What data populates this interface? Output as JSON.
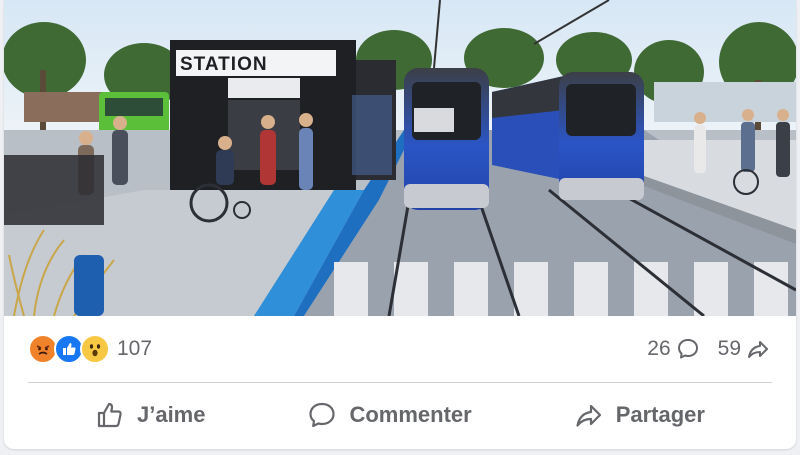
{
  "post": {
    "image": {
      "sign_text": "STATION"
    },
    "reactions": {
      "icons": [
        "angry-icon",
        "like-icon",
        "wow-icon"
      ],
      "count": "107"
    },
    "comments": {
      "count": "26",
      "icon": "comment-icon"
    },
    "shares": {
      "count": "59",
      "icon": "share-arrow-icon"
    },
    "actions": {
      "like_label": "J’aime",
      "comment_label": "Commenter",
      "share_label": "Partager"
    }
  },
  "colors": {
    "facebook_blue": "#1877f2",
    "angry_orange": "#f0822a",
    "wow_yellow": "#f7c843",
    "text_gray": "#65676b",
    "tram_blue": "#2b55c6"
  }
}
